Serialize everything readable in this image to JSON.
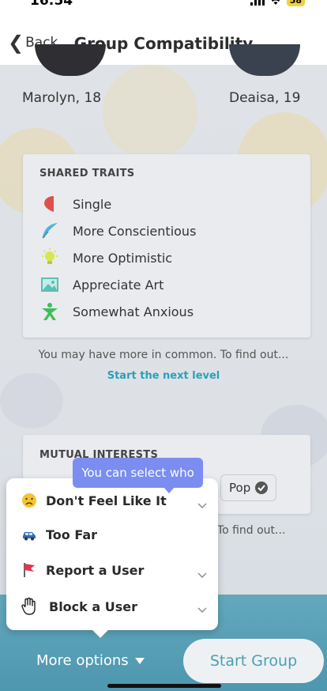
{
  "status_bar": {
    "time": "16:54",
    "battery": "58"
  },
  "nav": {
    "back_label": "Back",
    "title": "Group Compatibility"
  },
  "members": [
    {
      "name": "Marolyn, 18"
    },
    {
      "name": "Deaisa, 19"
    }
  ],
  "shared_traits": {
    "heading": "SHARED TRAITS",
    "items": [
      {
        "label": "Single",
        "icon": "heart-half-icon"
      },
      {
        "label": "More Conscientious",
        "icon": "feather-icon"
      },
      {
        "label": "More Optimistic",
        "icon": "lightbulb-icon"
      },
      {
        "label": "Appreciate Art",
        "icon": "picture-icon"
      },
      {
        "label": "Somewhat Anxious",
        "icon": "person-x-icon"
      }
    ],
    "more_note": "You may have more in common. To find out...",
    "next_level": "Start the next level"
  },
  "mutual_interests": {
    "heading": "MUTUAL INTERESTS",
    "tag": "Pop",
    "more_note_partial": ". To find out..."
  },
  "tooltip": "You can select who",
  "options_menu": {
    "items": [
      {
        "label": "Don't Feel Like It",
        "icon": "disappointed-face-icon"
      },
      {
        "label": "Too Far",
        "icon": "car-icon"
      },
      {
        "label": "Report a User",
        "icon": "flag-icon"
      },
      {
        "label": "Block a User",
        "icon": "raised-hand-icon"
      }
    ]
  },
  "bottom": {
    "more_options": "More options",
    "start_group": "Start Group"
  },
  "colors": {
    "accent": "#4a9fb7",
    "tooltip": "#7b8df0",
    "bar": "#5aa1b7"
  }
}
